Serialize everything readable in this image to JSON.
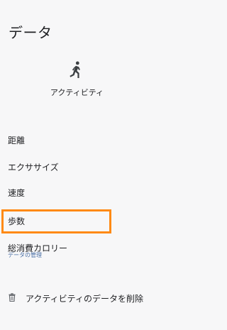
{
  "header": {
    "title": "データ"
  },
  "activity": {
    "icon": "running-person-icon",
    "label": "アクティビティ"
  },
  "menu": {
    "items": [
      {
        "label": "距離"
      },
      {
        "label": "エクササイズ"
      },
      {
        "label": "速度"
      },
      {
        "label": "歩数"
      },
      {
        "label": "総消費カロリー"
      }
    ],
    "highlight_color": "#ff8a14"
  },
  "data_management": {
    "section_label": "データの管理",
    "delete_label": "アクティビティのデータを削除",
    "delete_icon": "trash-icon"
  }
}
